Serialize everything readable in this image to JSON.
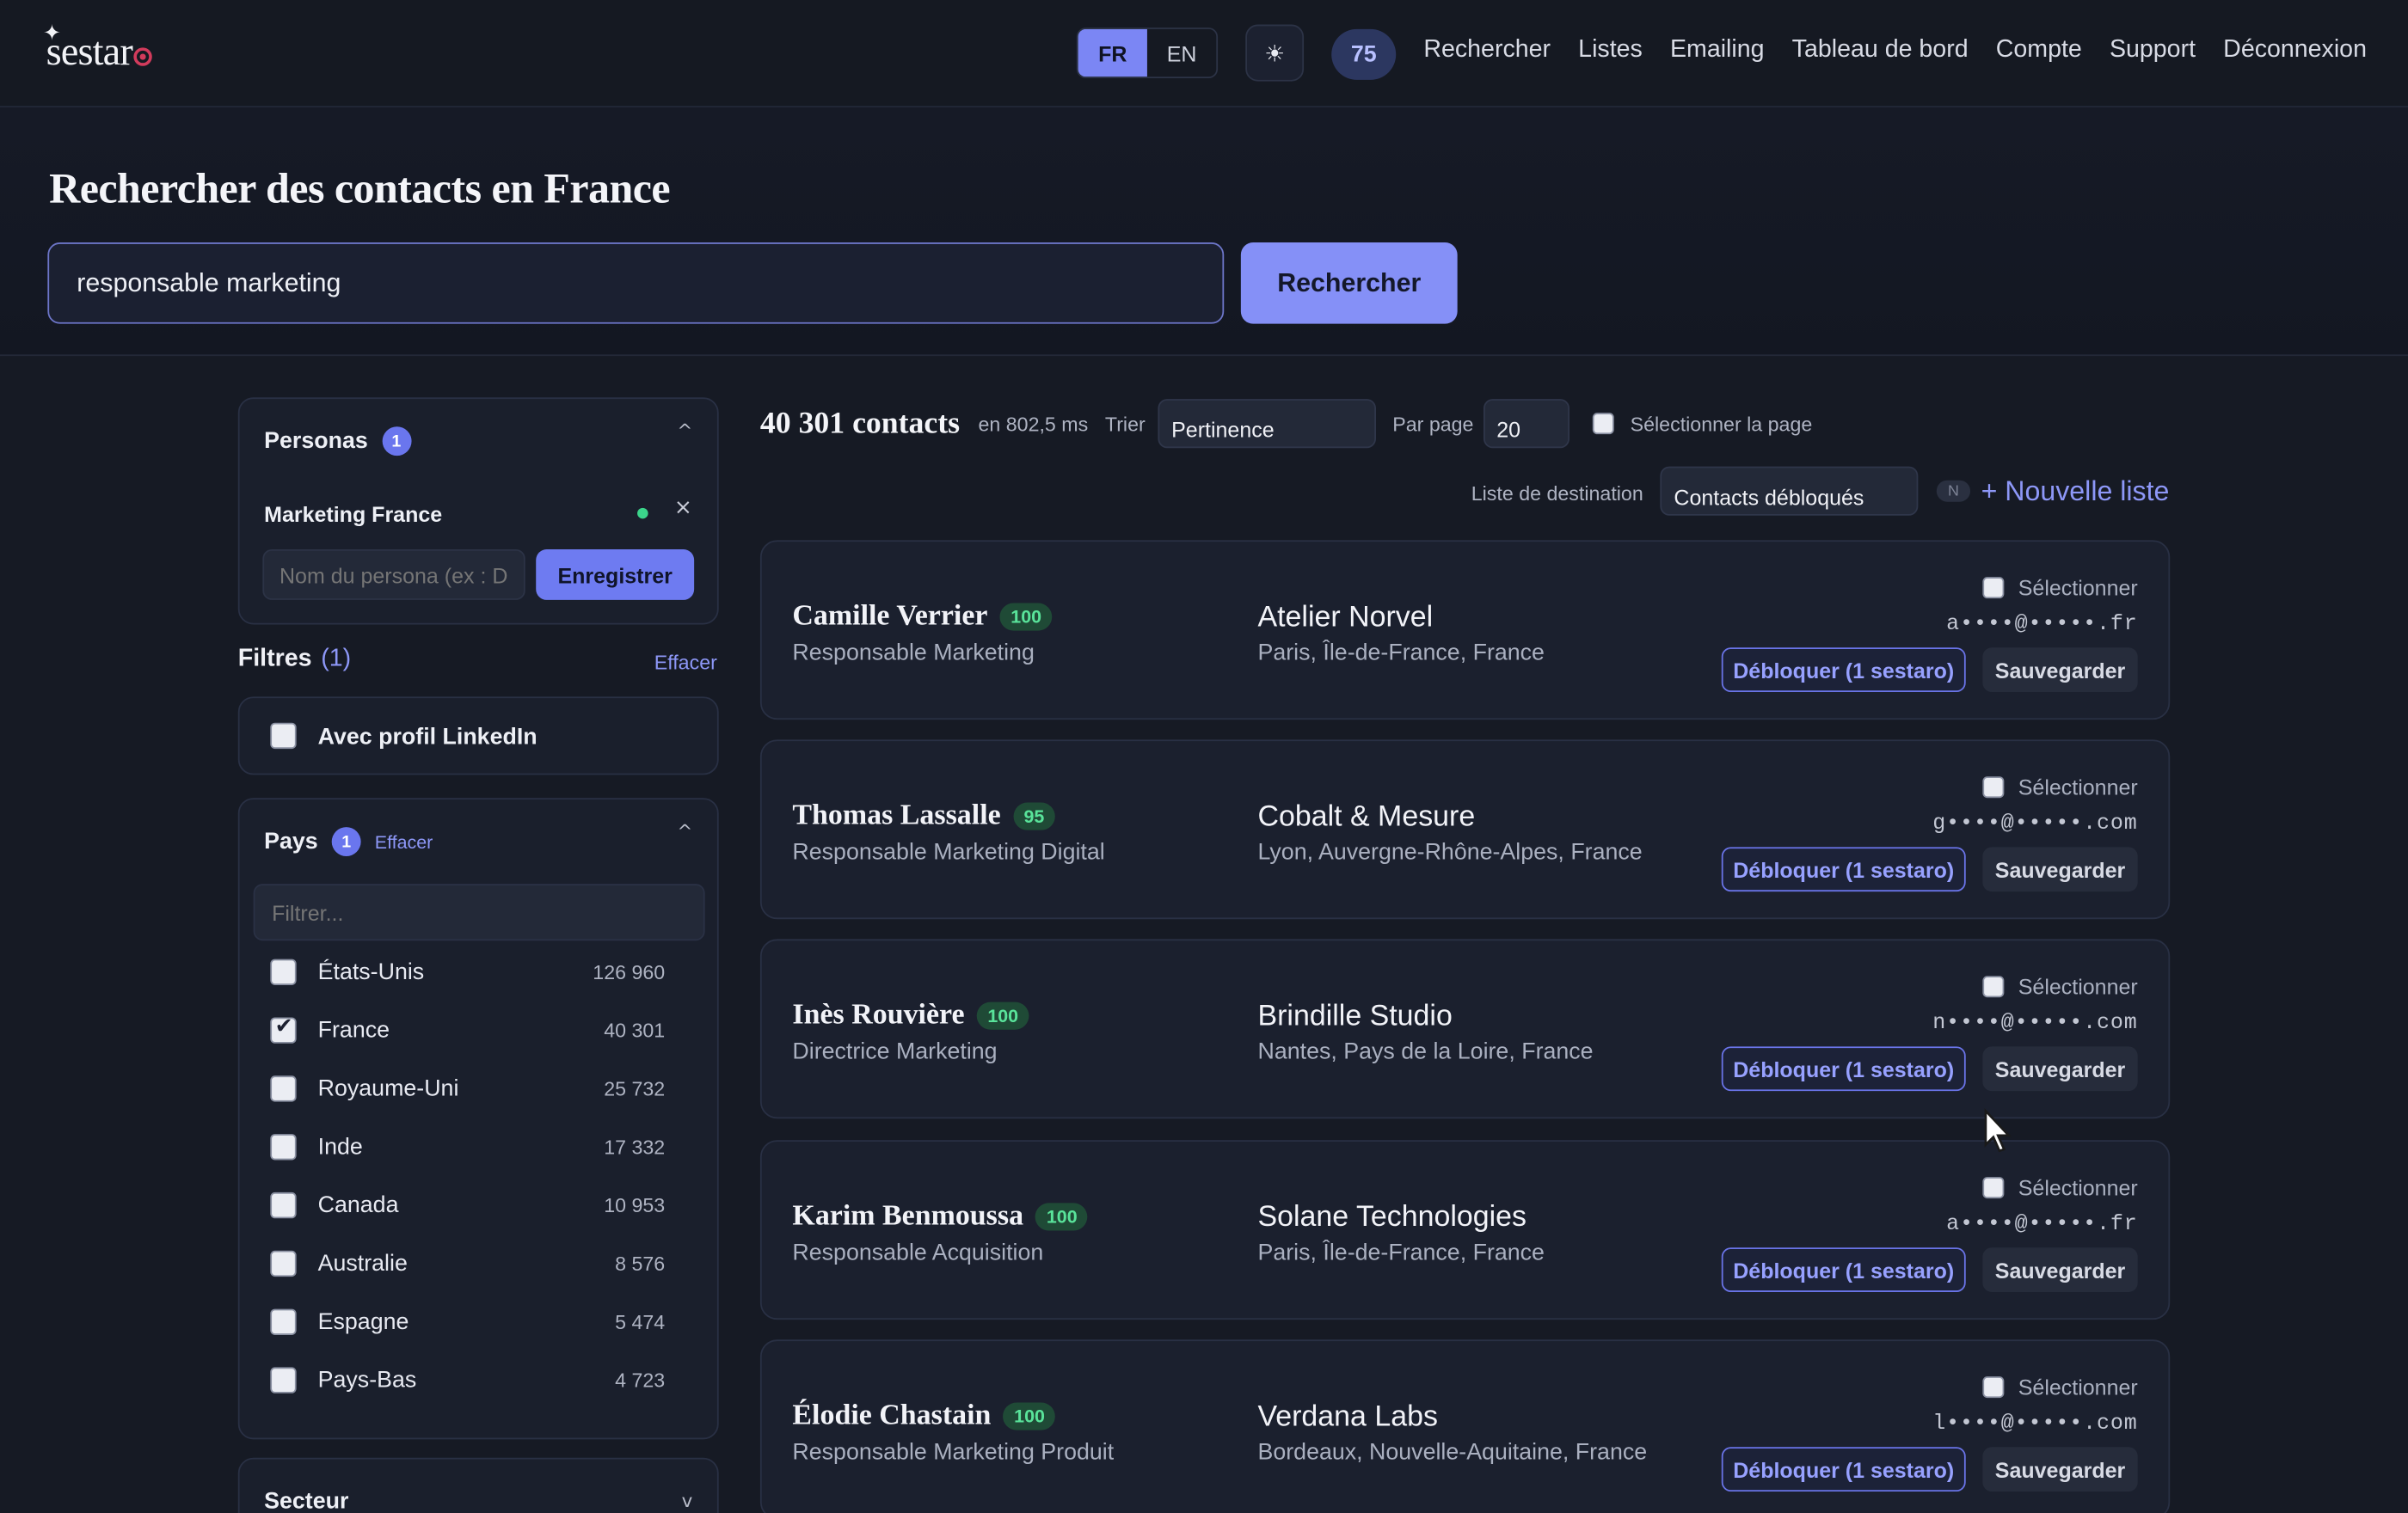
{
  "brand": {
    "logo_text": "sestar"
  },
  "nav": {
    "lang_fr": "FR",
    "lang_en": "EN",
    "theme_icon": "sun-icon",
    "credits": "75",
    "links": [
      "Rechercher",
      "Listes",
      "Emailing",
      "Tableau de bord",
      "Compte",
      "Support",
      "Déconnexion"
    ]
  },
  "hero": {
    "title": "Rechercher des contacts en France",
    "search_value": "responsable marketing",
    "search_button": "Rechercher"
  },
  "sidebar": {
    "personas": {
      "title": "Personas",
      "count": "1",
      "item": "Marketing France",
      "input_placeholder": "Nom du persona (ex : DR",
      "save_button": "Enregistrer"
    },
    "filters": {
      "title": "Filtres",
      "count": "(1)",
      "clear": "Effacer",
      "linkedin": "Avec profil LinkedIn"
    },
    "pays": {
      "title": "Pays",
      "count": "1",
      "clear": "Effacer",
      "filter_placeholder": "Filtrer...",
      "countries": [
        {
          "name": "États-Unis",
          "count": "126 960",
          "checked": false
        },
        {
          "name": "France",
          "count": "40 301",
          "checked": true
        },
        {
          "name": "Royaume-Uni",
          "count": "25 732",
          "checked": false
        },
        {
          "name": "Inde",
          "count": "17 332",
          "checked": false
        },
        {
          "name": "Canada",
          "count": "10 953",
          "checked": false
        },
        {
          "name": "Australie",
          "count": "8 576",
          "checked": false
        },
        {
          "name": "Espagne",
          "count": "5 474",
          "checked": false
        },
        {
          "name": "Pays-Bas",
          "count": "4 723",
          "checked": false
        }
      ]
    },
    "secteur": {
      "title": "Secteur"
    }
  },
  "results": {
    "count": "40 301 contacts",
    "time": "en 802,5 ms",
    "sort_label": "Trier",
    "sort_value": "Pertinence",
    "per_page_label": "Par page",
    "per_page_value": "20",
    "select_page": "Sélectionner la page",
    "dest_label": "Liste de destination",
    "dest_value": "Contacts débloqués",
    "toggle_text": "N",
    "new_list": "+ Nouvelle liste",
    "select_label": "Sélectionner",
    "unlock_label": "Débloquer (1 sestaro)",
    "save_label": "Sauvegarder",
    "contacts": [
      {
        "name": "Camille Verrier",
        "score": "100",
        "title": "Responsable Marketing",
        "company": "Atelier Norvel",
        "location": "Paris, Île-de-France, France",
        "email": "a••••@•••••.fr"
      },
      {
        "name": "Thomas Lassalle",
        "score": "95",
        "title": "Responsable Marketing Digital",
        "company": "Cobalt & Mesure",
        "location": "Lyon, Auvergne-Rhône-Alpes, France",
        "email": "g••••@•••••.com"
      },
      {
        "name": "Inès Rouvière",
        "score": "100",
        "title": "Directrice Marketing",
        "company": "Brindille Studio",
        "location": "Nantes, Pays de la Loire, France",
        "email": "n••••@•••••.com"
      },
      {
        "name": "Karim Benmoussa",
        "score": "100",
        "title": "Responsable Acquisition",
        "company": "Solane Technologies",
        "location": "Paris, Île-de-France, France",
        "email": "a••••@•••••.fr"
      },
      {
        "name": "Élodie Chastain",
        "score": "100",
        "title": "Responsable Marketing Produit",
        "company": "Verdana Labs",
        "location": "Bordeaux, Nouvelle-Aquitaine, France",
        "email": "l••••@•••••.com"
      }
    ]
  }
}
